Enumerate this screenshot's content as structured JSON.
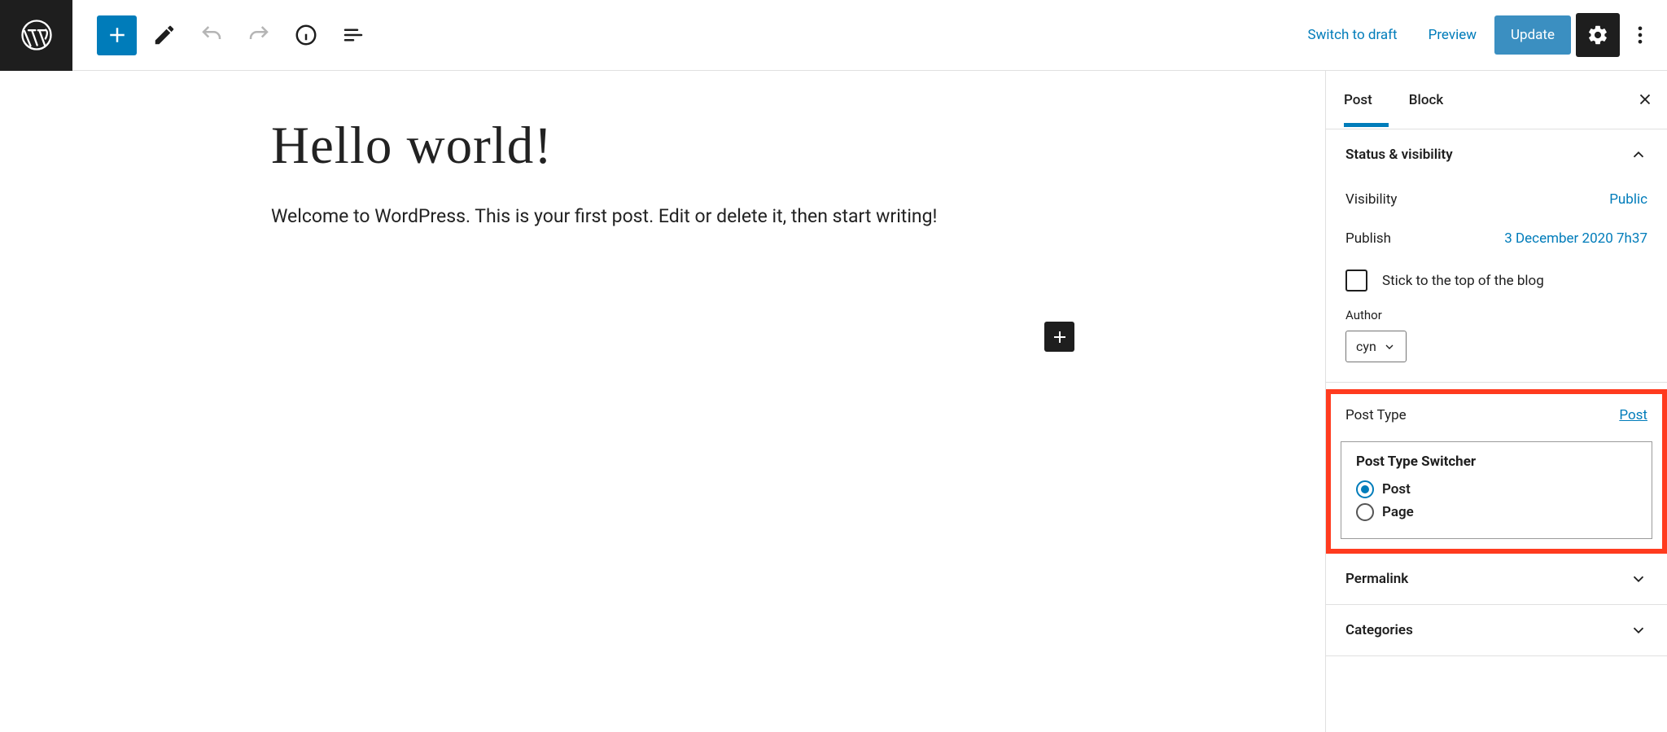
{
  "toolbar": {
    "switch_draft": "Switch to draft",
    "preview": "Preview",
    "update": "Update"
  },
  "editor": {
    "title": "Hello world!",
    "body": "Welcome to WordPress. This is your first post. Edit or delete it, then start writing!"
  },
  "sidebar": {
    "tabs": {
      "post": "Post",
      "block": "Block"
    },
    "status": {
      "heading": "Status & visibility",
      "visibility_label": "Visibility",
      "visibility_value": "Public",
      "publish_label": "Publish",
      "publish_value": "3 December 2020 7h37",
      "stick_label": "Stick to the top of the blog",
      "author_label": "Author",
      "author_value": "cyn"
    },
    "post_type": {
      "heading": "Post Type",
      "link": "Post",
      "switcher_title": "Post Type Switcher",
      "option_post": "Post",
      "option_page": "Page"
    },
    "permalink": {
      "heading": "Permalink"
    },
    "categories": {
      "heading": "Categories"
    }
  }
}
